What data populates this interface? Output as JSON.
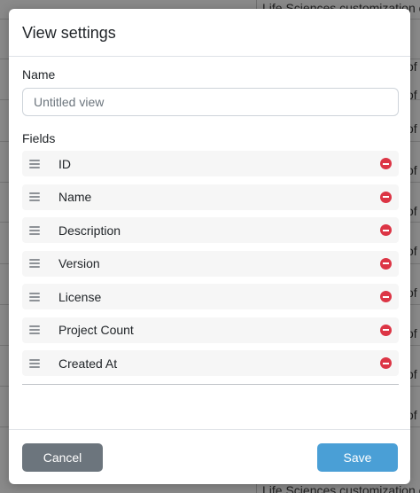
{
  "background": {
    "rows": [
      {
        "text": "Life Sciences customization o"
      },
      {
        "text": "of"
      },
      {
        "text": "of"
      },
      {
        "text": "of"
      },
      {
        "text": "of"
      },
      {
        "text": "of"
      },
      {
        "text": "of"
      },
      {
        "text": "of"
      },
      {
        "text": "of"
      },
      {
        "text": "of"
      },
      {
        "text": "of"
      },
      {
        "text": "Life Sciences customization o"
      }
    ]
  },
  "modal": {
    "title": "View settings",
    "name_label": "Name",
    "name_placeholder": "Untitled view",
    "name_value": "",
    "fields_label": "Fields",
    "fields": [
      {
        "label": "ID"
      },
      {
        "label": "Name"
      },
      {
        "label": "Description"
      },
      {
        "label": "Version"
      },
      {
        "label": "License"
      },
      {
        "label": "Project Count"
      },
      {
        "label": "Created At"
      }
    ],
    "cancel_label": "Cancel",
    "save_label": "Save"
  },
  "colors": {
    "primary": "#4a9fd6",
    "secondary": "#6c757d",
    "danger": "#dc3545"
  },
  "icons": {
    "drag": "drag-handle-icon",
    "remove": "remove-circle-icon"
  }
}
